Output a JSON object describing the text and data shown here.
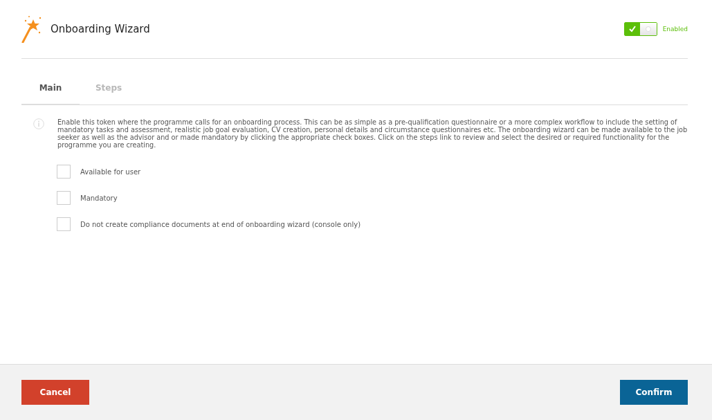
{
  "header": {
    "title": "Onboarding Wizard",
    "toggle": {
      "on": true,
      "label": "Enabled"
    }
  },
  "tabs": [
    {
      "label": "Main",
      "selected": true
    },
    {
      "label": "Steps",
      "selected": false
    }
  ],
  "info": "Enable this token where the programme calls for an onboarding process. This can be as simple as a pre-qualification questionnaire or a more complex workflow to include the setting of mandatory tasks and assessment, realistic job goal evaluation, CV creation, personal details and circumstance questionnaires etc. The onboarding wizard can be made available to the job seeker as well as the advisor and or made mandatory by clicking the appropriate check boxes. Click on the steps link to review and select the desired or required functionality for the programme you are creating.",
  "options": [
    {
      "label": "Available for user",
      "checked": false
    },
    {
      "label": "Mandatory",
      "checked": false
    },
    {
      "label": "Do not create compliance documents at end of onboarding wizard (console only)",
      "checked": false
    }
  ],
  "footer": {
    "cancel": "Cancel",
    "confirm": "Confirm"
  }
}
